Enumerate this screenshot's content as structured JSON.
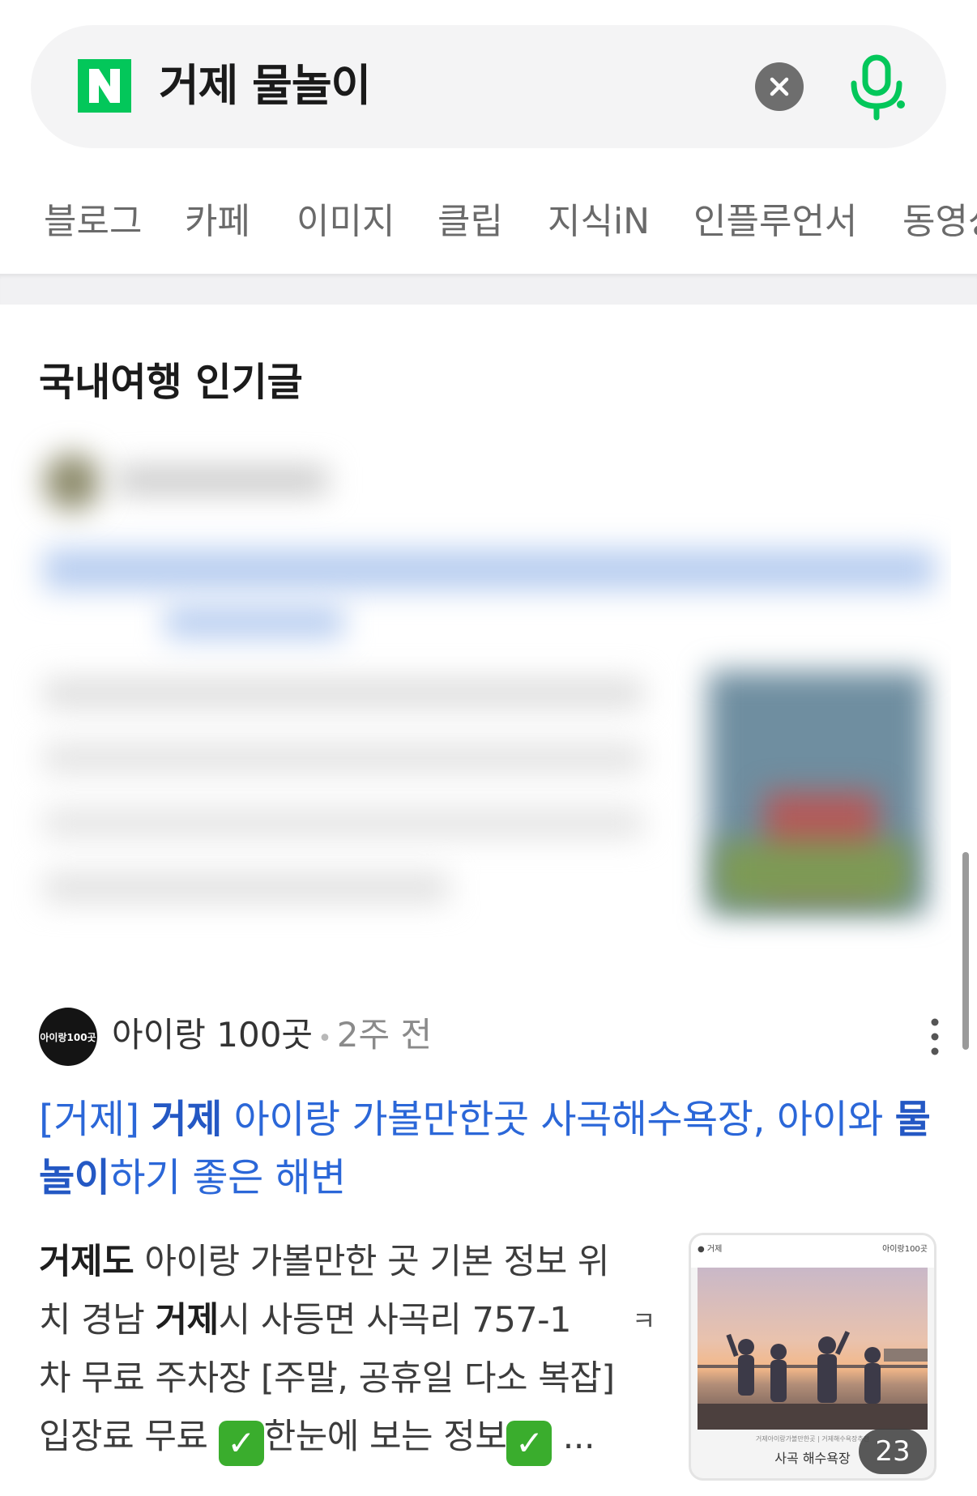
{
  "search": {
    "logo_letter": "N",
    "query": "거제 물놀이",
    "colors": {
      "brand": "#03c75a",
      "bar_bg": "#f4f4f5"
    }
  },
  "tabs": [
    "블로그",
    "카페",
    "이미지",
    "클립",
    "지식iN",
    "인플루언서",
    "동영상"
  ],
  "section": {
    "title": "국내여행 인기글"
  },
  "post": {
    "author": "아이랑 100곳",
    "avatar_text": "아이랑100곳",
    "time": "2주 전",
    "title_parts": [
      {
        "text": "[거제] ",
        "bold": false,
        "highlight": true
      },
      {
        "text": "거제",
        "bold": true
      },
      {
        "text": " 아이랑 가볼만한곳 사곡해수욕장, 아이와 ",
        "bold": false
      },
      {
        "text": "물놀이",
        "bold": true
      },
      {
        "text": "하기 좋은 해변",
        "bold": false
      }
    ],
    "body_line1_bold": "거제도",
    "body_line1": " 아이랑 가볼만한 곳 기본 정보 위",
    "body_line2_pre": "치 경남 ",
    "body_line2_bold": "거제",
    "body_line2": "시 사등면 사곡리 757-1",
    "body_line3": "차 무료 주차장 [주말, 공휴일 다소 복잡]",
    "body_line4_pre": "입장료 무료 ",
    "body_line4_mid": "한눈에 보는 정보",
    "body_line4_end": " ...",
    "check_glyph": "✓",
    "fragment": "ㅋ",
    "thumbnail": {
      "top_left": "● 거제",
      "top_right": "아이랑100곳",
      "sub": "거제아이랑가볼만한곳 | 거제해수욕장추천",
      "caption": "사곡 해수욕장",
      "image_count": "23"
    }
  }
}
